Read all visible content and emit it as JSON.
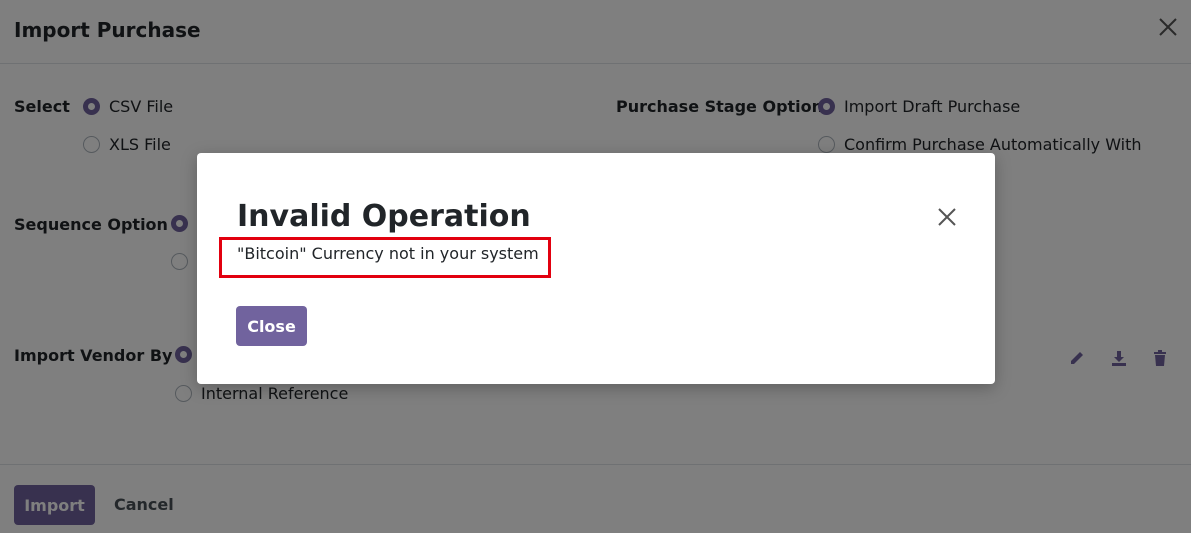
{
  "modal": {
    "title": "Import Purchase",
    "select": {
      "label": "Select",
      "options": [
        "CSV File",
        "XLS File"
      ],
      "selected": "CSV File"
    },
    "purchase_stage": {
      "label": "Purchase Stage Option",
      "options": [
        "Import Draft Purchase",
        "Confirm Purchase Automatically With"
      ],
      "selected": "Import Draft Purchase"
    },
    "sequence": {
      "label": "Sequence Option"
    },
    "vendor": {
      "label": "Import Vendor By",
      "options": [
        "Internal Reference"
      ]
    },
    "footer": {
      "import_label": "Import",
      "cancel_label": "Cancel"
    },
    "icons": [
      "close-icon",
      "pencil-icon",
      "download-icon",
      "trash-icon"
    ]
  },
  "dialog": {
    "title": "Invalid Operation",
    "message": "\"Bitcoin\" Currency not in your system",
    "close_label": "Close",
    "highlight_color": "#e2000f"
  },
  "colors": {
    "primary": "#71639e",
    "overlay": "rgba(0,0,0,0.5)"
  }
}
